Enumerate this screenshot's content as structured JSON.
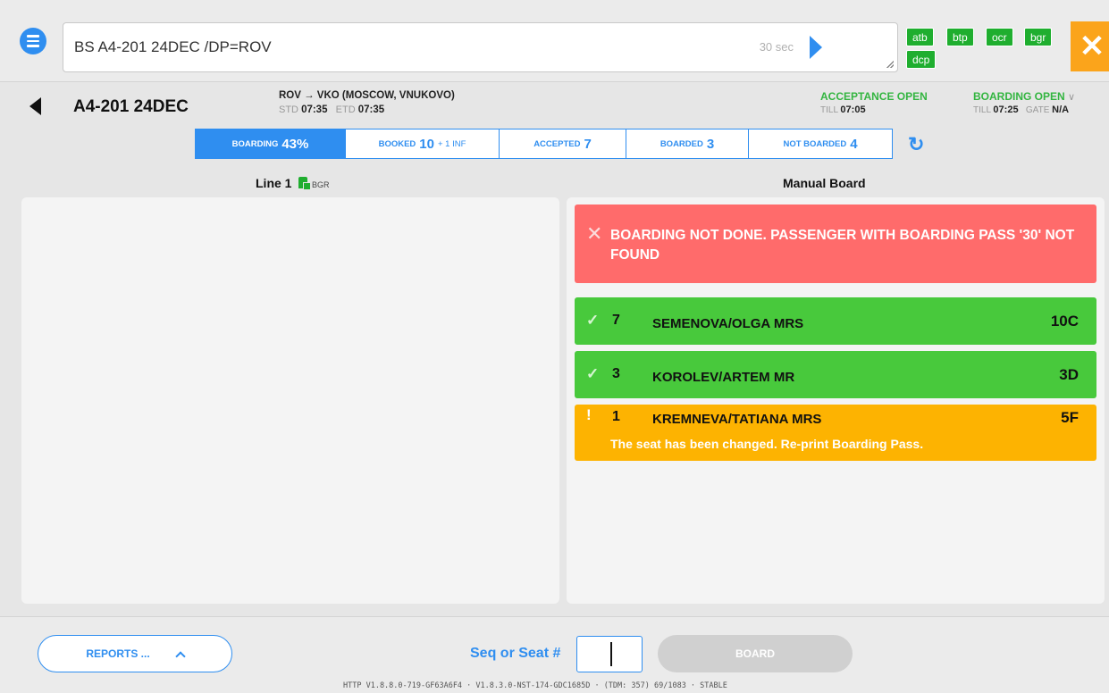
{
  "command": {
    "text": "BS A4-201 24DEC /DP=ROV",
    "timer": "30 sec"
  },
  "quick_buttons": [
    "atb",
    "btp",
    "ocr",
    "bgr",
    "dcp"
  ],
  "flight": {
    "id": "A4-201 24DEC",
    "route": "ROV → VKO (MOSCOW, VNUKOVO)",
    "std_label": "STD",
    "std": "07:35",
    "etd_label": "ETD",
    "etd": "07:35",
    "acceptance_status": "ACCEPTANCE OPEN",
    "acceptance_till_label": "TILL",
    "acceptance_till": "07:05",
    "boarding_status": "BOARDING OPEN",
    "boarding_till_label": "TILL",
    "boarding_till": "07:25",
    "gate_label": "GATE",
    "gate": "N/A"
  },
  "stats": {
    "boarding_label": "BOARDING",
    "boarding_value": "43%",
    "booked_label": "BOOKED",
    "booked_value": "10",
    "booked_extra": "+ 1 INF",
    "accepted_label": "ACCEPTED",
    "accepted_value": "7",
    "boarded_label": "BOARDED",
    "boarded_value": "3",
    "not_boarded_label": "NOT BOARDED",
    "not_boarded_value": "4"
  },
  "line": {
    "label": "Line 1",
    "tag": "BGR"
  },
  "manual_board": {
    "title": "Manual Board",
    "error": "BOARDING NOT DONE. PASSENGER WITH BOARDING PASS '30' NOT FOUND",
    "passengers": [
      {
        "seq": "7",
        "name": "SEMENOVA/OLGA MRS",
        "seat": "10C",
        "status": "ok"
      },
      {
        "seq": "3",
        "name": "KOROLEV/ARTEM MR",
        "seat": "3D",
        "status": "ok"
      },
      {
        "seq": "1",
        "name": "KREMNEVA/TATIANA MRS",
        "seat": "5F",
        "status": "warning",
        "note": "The seat has been changed. Re-print Boarding Pass."
      }
    ]
  },
  "bottom": {
    "reports_label": "REPORTS ...",
    "seq_label": "Seq or Seat #",
    "seq_value": "",
    "board_label": "BOARD",
    "version": "HTTP V1.8.8.0-719-GF63A6F4 · V1.8.3.0-NST-174-GDC1685D · (TDM: 357) 69/1083 · STABLE"
  },
  "colors": {
    "accent": "#2f8ef0",
    "success": "#48c93c",
    "error": "#ff6b6b",
    "warning": "#fdb301",
    "close": "#fba41b"
  }
}
